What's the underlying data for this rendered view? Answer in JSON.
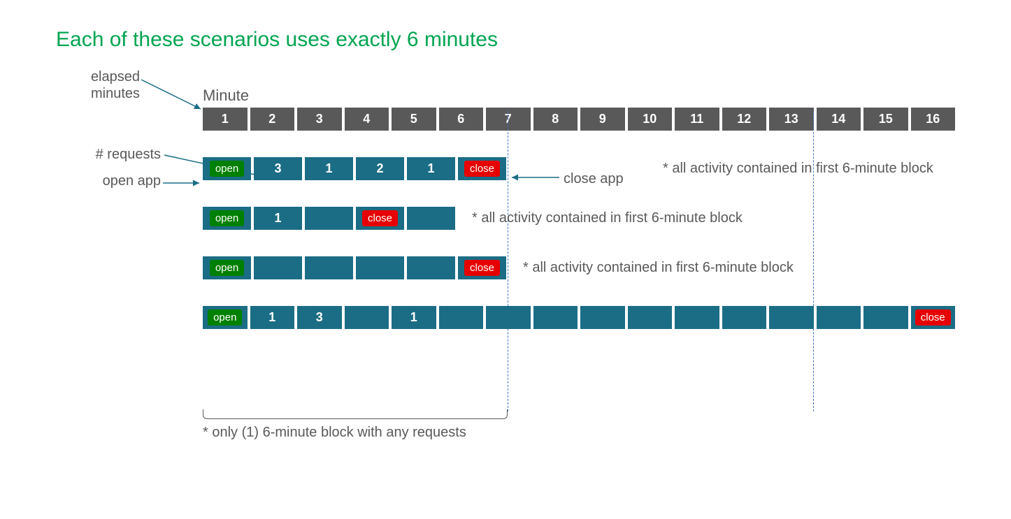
{
  "title": "Each of these scenarios uses exactly 6 minutes",
  "labels": {
    "elapsed": "elapsed\nminutes",
    "minute": "Minute",
    "requests": "# requests",
    "openApp": "open app",
    "closeApp": "close app"
  },
  "header": [
    "1",
    "2",
    "3",
    "4",
    "5",
    "6",
    "7",
    "8",
    "9",
    "10",
    "11",
    "12",
    "13",
    "14",
    "15",
    "16"
  ],
  "open": "open",
  "close": "close",
  "rows": [
    {
      "cells": [
        "open",
        "3",
        "1",
        "2",
        "1",
        "close"
      ],
      "note": "* all activity contained in first 6-minute block",
      "closeLabel": true
    },
    {
      "cells": [
        "open",
        "1",
        "",
        "close",
        ""
      ],
      "note": "* all activity contained in first 6-minute block"
    },
    {
      "cells": [
        "open",
        "",
        "",
        "",
        "",
        "close"
      ],
      "note": "* all activity contained in first 6-minute block"
    },
    {
      "cells": [
        "open",
        "1",
        "3",
        "",
        "1",
        "",
        "",
        "",
        "",
        "",
        "",
        "",
        "",
        "",
        "",
        "close"
      ],
      "note": ""
    }
  ],
  "brace": "* only (1) 6-minute block with any requests"
}
